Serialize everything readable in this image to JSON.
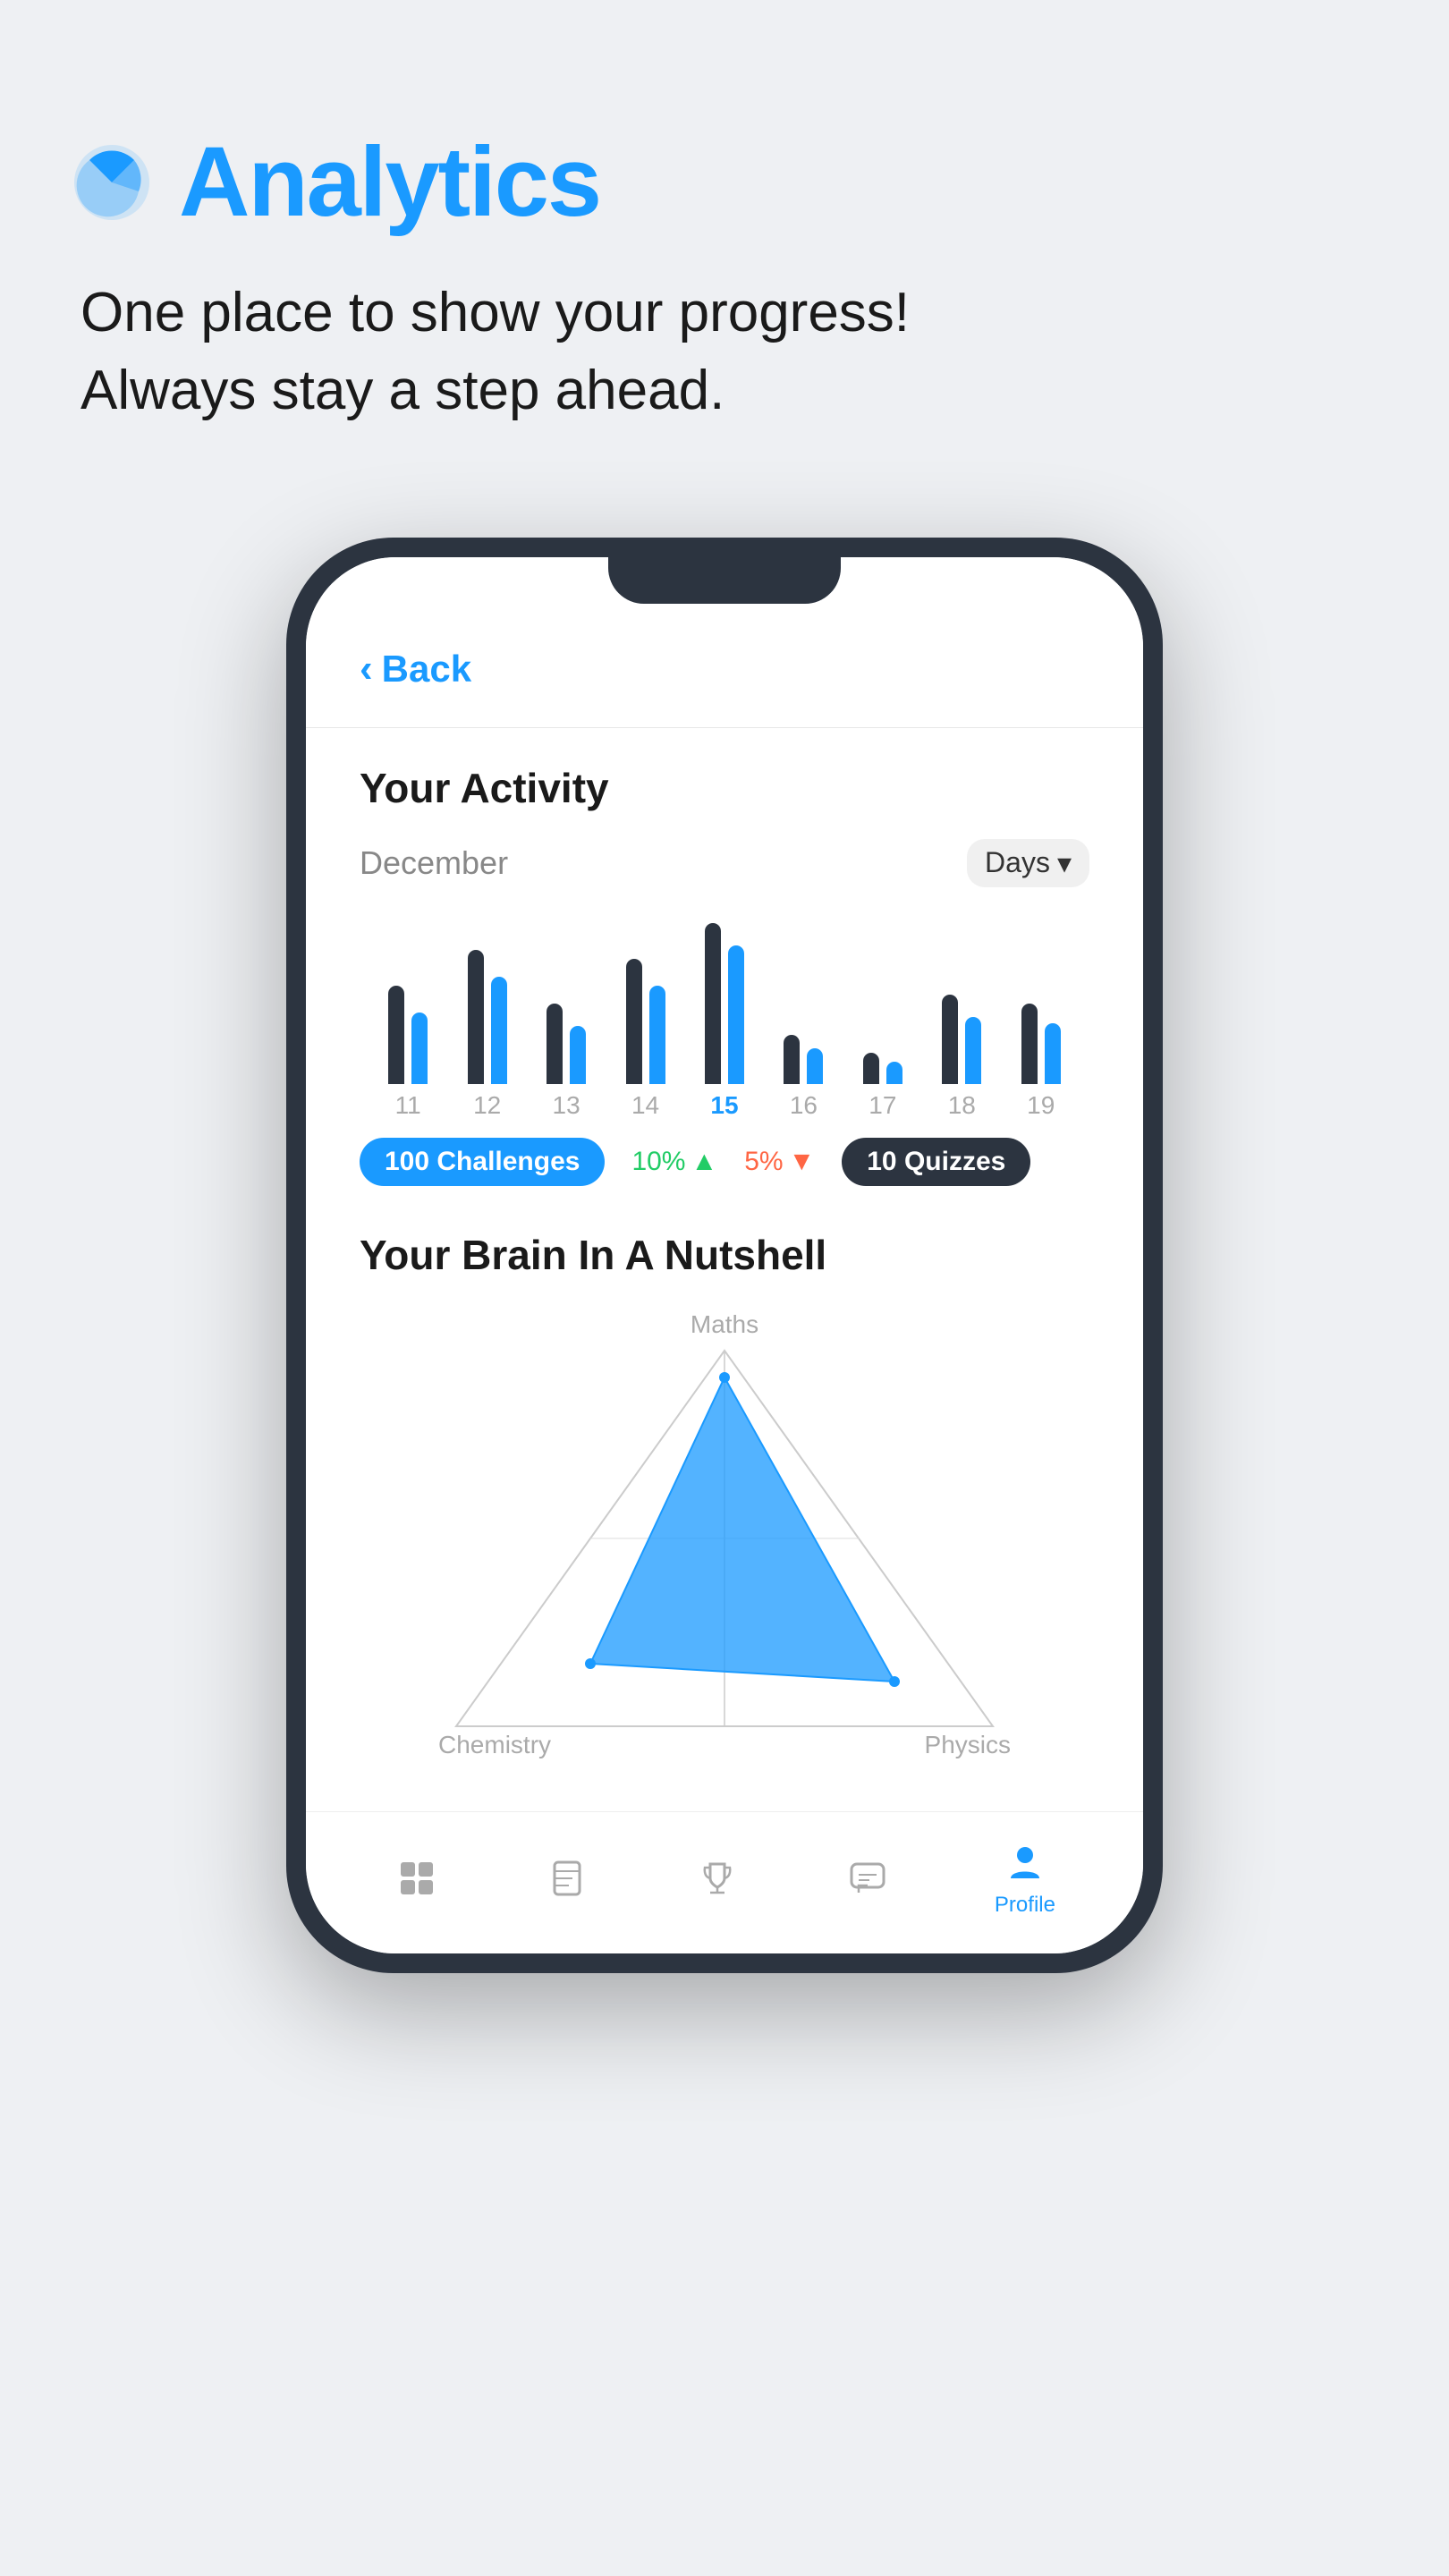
{
  "header": {
    "title": "Analytics",
    "subtitle_line1": "One place to show your progress!",
    "subtitle_line2": "Always stay a step ahead.",
    "icon": "analytics-icon"
  },
  "phone": {
    "back_label": "Back",
    "activity_section": {
      "title": "Your Activity",
      "month": "December",
      "filter": "Days",
      "bars": [
        {
          "label": "11",
          "dark_h": 110,
          "blue_h": 80,
          "active": false
        },
        {
          "label": "12",
          "dark_h": 150,
          "blue_h": 130,
          "active": false
        },
        {
          "label": "13",
          "dark_h": 90,
          "blue_h": 70,
          "active": false
        },
        {
          "label": "14",
          "dark_h": 140,
          "blue_h": 110,
          "active": false
        },
        {
          "label": "15",
          "dark_h": 180,
          "blue_h": 160,
          "active": true
        },
        {
          "label": "16",
          "dark_h": 60,
          "blue_h": 50,
          "active": false
        },
        {
          "label": "17",
          "dark_h": 40,
          "blue_h": 30,
          "active": false
        },
        {
          "label": "18",
          "dark_h": 100,
          "blue_h": 80,
          "active": false
        },
        {
          "label": "19",
          "dark_h": 95,
          "blue_h": 75,
          "active": false
        }
      ],
      "stats": [
        {
          "label": "100 Challenges",
          "type": "blue"
        },
        {
          "label": "10%",
          "type": "green_percent",
          "arrow": "up"
        },
        {
          "label": "5%",
          "type": "red_percent",
          "arrow": "down"
        },
        {
          "label": "10 Quizzes",
          "type": "dark"
        }
      ]
    },
    "brain_section": {
      "title": "Your Brain In A Nutshell",
      "labels": {
        "top": "Maths",
        "bottom_left": "Chemistry",
        "bottom_right": "Physics"
      }
    },
    "bottom_nav": [
      {
        "icon": "grid-icon",
        "label": "",
        "active": false
      },
      {
        "icon": "book-icon",
        "label": "",
        "active": false
      },
      {
        "icon": "trophy-icon",
        "label": "",
        "active": false
      },
      {
        "icon": "chat-icon",
        "label": "",
        "active": false
      },
      {
        "icon": "profile-icon",
        "label": "Profile",
        "active": true
      }
    ]
  },
  "colors": {
    "blue": "#1a9aff",
    "dark": "#2c3440",
    "green": "#22cc66",
    "red": "#ff6644",
    "bg": "#eef0f3"
  }
}
